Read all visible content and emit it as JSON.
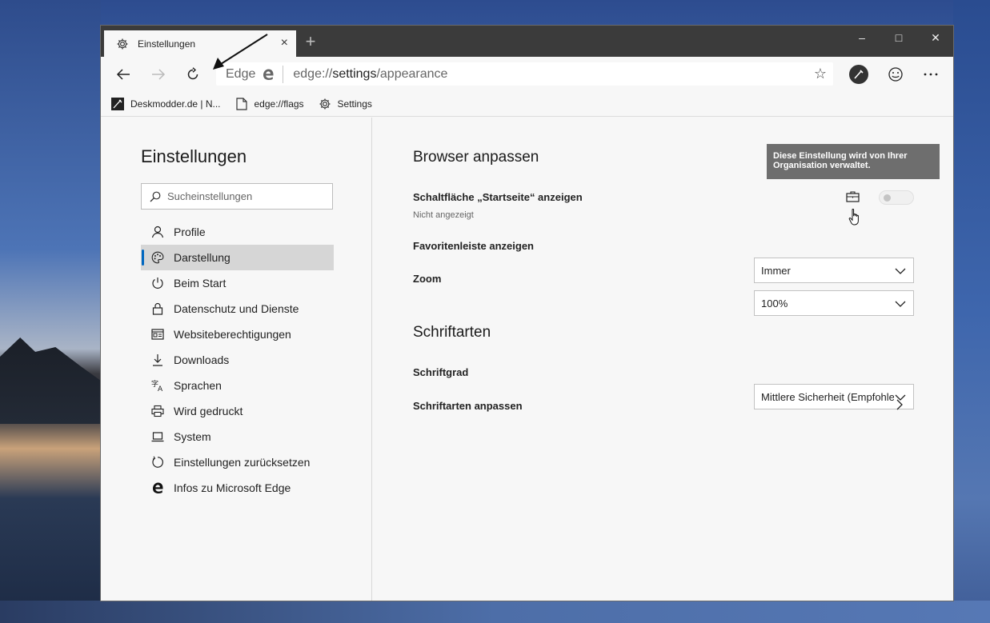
{
  "tab": {
    "title": "Einstellungen",
    "close": "×",
    "new_tab": "+"
  },
  "window_controls": {
    "minimize": "–",
    "maximize": "□",
    "close": "✕"
  },
  "addressbar": {
    "site_label": "Edge",
    "url_prefix": "edge://",
    "url_host": "settings",
    "url_path": "/appearance"
  },
  "favorites": [
    {
      "label": "Deskmodder.de | N...",
      "icon": "deskmodder-icon"
    },
    {
      "label": "edge://flags",
      "icon": "page-icon"
    },
    {
      "label": "Settings",
      "icon": "gear-icon"
    }
  ],
  "sidebar": {
    "title": "Einstellungen",
    "search_placeholder": "Sucheinstellungen",
    "items": [
      {
        "label": "Profile",
        "icon": "profile-icon",
        "active": false
      },
      {
        "label": "Darstellung",
        "icon": "palette-icon",
        "active": true
      },
      {
        "label": "Beim Start",
        "icon": "power-icon",
        "active": false
      },
      {
        "label": "Datenschutz und Dienste",
        "icon": "lock-icon",
        "active": false
      },
      {
        "label": "Websiteberechtigungen",
        "icon": "site-permissions-icon",
        "active": false
      },
      {
        "label": "Downloads",
        "icon": "download-icon",
        "active": false
      },
      {
        "label": "Sprachen",
        "icon": "language-icon",
        "active": false
      },
      {
        "label": "Wird gedruckt",
        "icon": "printer-icon",
        "active": false
      },
      {
        "label": "System",
        "icon": "laptop-icon",
        "active": false
      },
      {
        "label": "Einstellungen zurücksetzen",
        "icon": "reset-icon",
        "active": false
      },
      {
        "label": "Infos zu Microsoft Edge",
        "icon": "edge-icon",
        "active": false
      }
    ]
  },
  "content": {
    "section1_title": "Browser anpassen",
    "tooltip_text": "Diese Einstellung wird von Ihrer Organisation verwaltet.",
    "home_button_label": "Schaltfläche „Startseite“ anzeigen",
    "home_button_sub": "Nicht angezeigt",
    "home_button_enabled": false,
    "favbar_label": "Favoritenleiste anzeigen",
    "favbar_value": "Immer",
    "zoom_label": "Zoom",
    "zoom_value": "100%",
    "section2_title": "Schriftarten",
    "fontsize_label": "Schriftgrad",
    "fontsize_value": "Mittlere Sicherheit (Empfohlen)",
    "customize_fonts_label": "Schriftarten anpassen"
  },
  "colors": {
    "accent": "#0067c0",
    "titlebar": "#3b3b3b",
    "tooltip": "#6e6e6e"
  }
}
